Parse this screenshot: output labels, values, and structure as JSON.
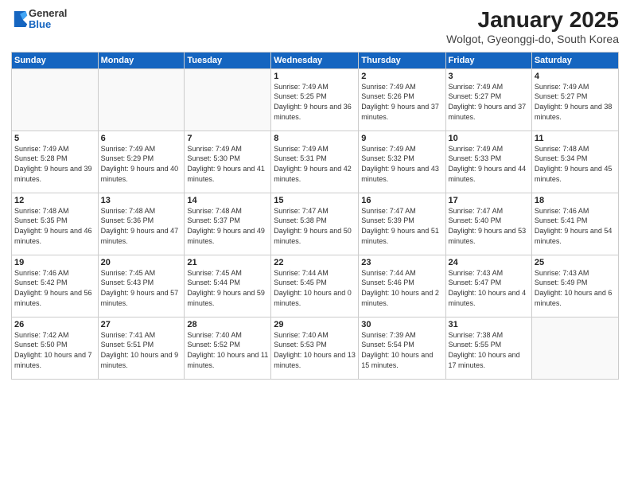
{
  "header": {
    "logo_general": "General",
    "logo_blue": "Blue",
    "title": "January 2025",
    "subtitle": "Wolgot, Gyeonggi-do, South Korea"
  },
  "weekdays": [
    "Sunday",
    "Monday",
    "Tuesday",
    "Wednesday",
    "Thursday",
    "Friday",
    "Saturday"
  ],
  "weeks": [
    [
      {
        "day": "",
        "info": ""
      },
      {
        "day": "",
        "info": ""
      },
      {
        "day": "",
        "info": ""
      },
      {
        "day": "1",
        "info": "Sunrise: 7:49 AM\nSunset: 5:25 PM\nDaylight: 9 hours and 36 minutes."
      },
      {
        "day": "2",
        "info": "Sunrise: 7:49 AM\nSunset: 5:26 PM\nDaylight: 9 hours and 37 minutes."
      },
      {
        "day": "3",
        "info": "Sunrise: 7:49 AM\nSunset: 5:27 PM\nDaylight: 9 hours and 37 minutes."
      },
      {
        "day": "4",
        "info": "Sunrise: 7:49 AM\nSunset: 5:27 PM\nDaylight: 9 hours and 38 minutes."
      }
    ],
    [
      {
        "day": "5",
        "info": "Sunrise: 7:49 AM\nSunset: 5:28 PM\nDaylight: 9 hours and 39 minutes."
      },
      {
        "day": "6",
        "info": "Sunrise: 7:49 AM\nSunset: 5:29 PM\nDaylight: 9 hours and 40 minutes."
      },
      {
        "day": "7",
        "info": "Sunrise: 7:49 AM\nSunset: 5:30 PM\nDaylight: 9 hours and 41 minutes."
      },
      {
        "day": "8",
        "info": "Sunrise: 7:49 AM\nSunset: 5:31 PM\nDaylight: 9 hours and 42 minutes."
      },
      {
        "day": "9",
        "info": "Sunrise: 7:49 AM\nSunset: 5:32 PM\nDaylight: 9 hours and 43 minutes."
      },
      {
        "day": "10",
        "info": "Sunrise: 7:49 AM\nSunset: 5:33 PM\nDaylight: 9 hours and 44 minutes."
      },
      {
        "day": "11",
        "info": "Sunrise: 7:48 AM\nSunset: 5:34 PM\nDaylight: 9 hours and 45 minutes."
      }
    ],
    [
      {
        "day": "12",
        "info": "Sunrise: 7:48 AM\nSunset: 5:35 PM\nDaylight: 9 hours and 46 minutes."
      },
      {
        "day": "13",
        "info": "Sunrise: 7:48 AM\nSunset: 5:36 PM\nDaylight: 9 hours and 47 minutes."
      },
      {
        "day": "14",
        "info": "Sunrise: 7:48 AM\nSunset: 5:37 PM\nDaylight: 9 hours and 49 minutes."
      },
      {
        "day": "15",
        "info": "Sunrise: 7:47 AM\nSunset: 5:38 PM\nDaylight: 9 hours and 50 minutes."
      },
      {
        "day": "16",
        "info": "Sunrise: 7:47 AM\nSunset: 5:39 PM\nDaylight: 9 hours and 51 minutes."
      },
      {
        "day": "17",
        "info": "Sunrise: 7:47 AM\nSunset: 5:40 PM\nDaylight: 9 hours and 53 minutes."
      },
      {
        "day": "18",
        "info": "Sunrise: 7:46 AM\nSunset: 5:41 PM\nDaylight: 9 hours and 54 minutes."
      }
    ],
    [
      {
        "day": "19",
        "info": "Sunrise: 7:46 AM\nSunset: 5:42 PM\nDaylight: 9 hours and 56 minutes."
      },
      {
        "day": "20",
        "info": "Sunrise: 7:45 AM\nSunset: 5:43 PM\nDaylight: 9 hours and 57 minutes."
      },
      {
        "day": "21",
        "info": "Sunrise: 7:45 AM\nSunset: 5:44 PM\nDaylight: 9 hours and 59 minutes."
      },
      {
        "day": "22",
        "info": "Sunrise: 7:44 AM\nSunset: 5:45 PM\nDaylight: 10 hours and 0 minutes."
      },
      {
        "day": "23",
        "info": "Sunrise: 7:44 AM\nSunset: 5:46 PM\nDaylight: 10 hours and 2 minutes."
      },
      {
        "day": "24",
        "info": "Sunrise: 7:43 AM\nSunset: 5:47 PM\nDaylight: 10 hours and 4 minutes."
      },
      {
        "day": "25",
        "info": "Sunrise: 7:43 AM\nSunset: 5:49 PM\nDaylight: 10 hours and 6 minutes."
      }
    ],
    [
      {
        "day": "26",
        "info": "Sunrise: 7:42 AM\nSunset: 5:50 PM\nDaylight: 10 hours and 7 minutes."
      },
      {
        "day": "27",
        "info": "Sunrise: 7:41 AM\nSunset: 5:51 PM\nDaylight: 10 hours and 9 minutes."
      },
      {
        "day": "28",
        "info": "Sunrise: 7:40 AM\nSunset: 5:52 PM\nDaylight: 10 hours and 11 minutes."
      },
      {
        "day": "29",
        "info": "Sunrise: 7:40 AM\nSunset: 5:53 PM\nDaylight: 10 hours and 13 minutes."
      },
      {
        "day": "30",
        "info": "Sunrise: 7:39 AM\nSunset: 5:54 PM\nDaylight: 10 hours and 15 minutes."
      },
      {
        "day": "31",
        "info": "Sunrise: 7:38 AM\nSunset: 5:55 PM\nDaylight: 10 hours and 17 minutes."
      },
      {
        "day": "",
        "info": ""
      }
    ]
  ]
}
